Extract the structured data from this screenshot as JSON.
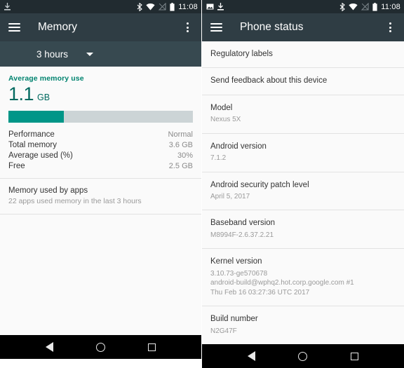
{
  "status_bar": {
    "time": "11:08",
    "left_icons_screen1": [
      "download-icon"
    ],
    "left_icons_screen2": [
      "screenshot-icon",
      "download-icon"
    ],
    "right_icons": [
      "bluetooth-icon",
      "wifi-icon",
      "signal-off-icon",
      "battery-icon"
    ]
  },
  "colors": {
    "toolbar": "#2f3d44",
    "spinner_bar": "#374950",
    "status_bar": "#212b30",
    "accent_teal": "#009688",
    "accent_teal_dark": "#00695f",
    "accent_label": "#00836f",
    "track": "#ccd4d6",
    "background": "#fafafa",
    "navbar": "#000000"
  },
  "screen1": {
    "toolbar": {
      "title": "Memory",
      "menu_icon": "hamburger-icon",
      "overflow_icon": "overflow-menu-icon"
    },
    "spinner": {
      "value": "3 hours",
      "caret_icon": "chevron-down-icon"
    },
    "memory_card": {
      "label": "Average memory use",
      "value_number": "1.1",
      "value_unit": "GB",
      "bar_percent": 30,
      "stats": [
        {
          "key": "Performance",
          "value": "Normal"
        },
        {
          "key": "Total memory",
          "value": "3.6 GB"
        },
        {
          "key": "Average used (%)",
          "value": "30%"
        },
        {
          "key": "Free",
          "value": "2.5 GB"
        }
      ]
    },
    "apps_section": {
      "title": "Memory used by apps",
      "subtitle": "22 apps used memory in the last 3 hours"
    }
  },
  "screen2": {
    "toolbar": {
      "title": "Phone status",
      "menu_icon": "hamburger-icon",
      "overflow_icon": "overflow-menu-icon"
    },
    "items": [
      {
        "title": "Regulatory labels",
        "lines": []
      },
      {
        "title": "Send feedback about this device",
        "lines": []
      },
      {
        "title": "Model",
        "lines": [
          "Nexus 5X"
        ]
      },
      {
        "title": "Android version",
        "lines": [
          "7.1.2"
        ]
      },
      {
        "title": "Android security patch level",
        "lines": [
          "April 5, 2017"
        ]
      },
      {
        "title": "Baseband version",
        "lines": [
          "M8994F-2.6.37.2.21"
        ]
      },
      {
        "title": "Kernel version",
        "lines": [
          "3.10.73-ge570678",
          "android-build@wphq2.hot.corp.google.com #1",
          "Thu Feb 16 03:27:36 UTC 2017"
        ]
      },
      {
        "title": "Build number",
        "lines": [
          "N2G47F"
        ]
      }
    ]
  },
  "navbar": {
    "back_label": "Back",
    "home_label": "Home",
    "recents_label": "Recents"
  }
}
